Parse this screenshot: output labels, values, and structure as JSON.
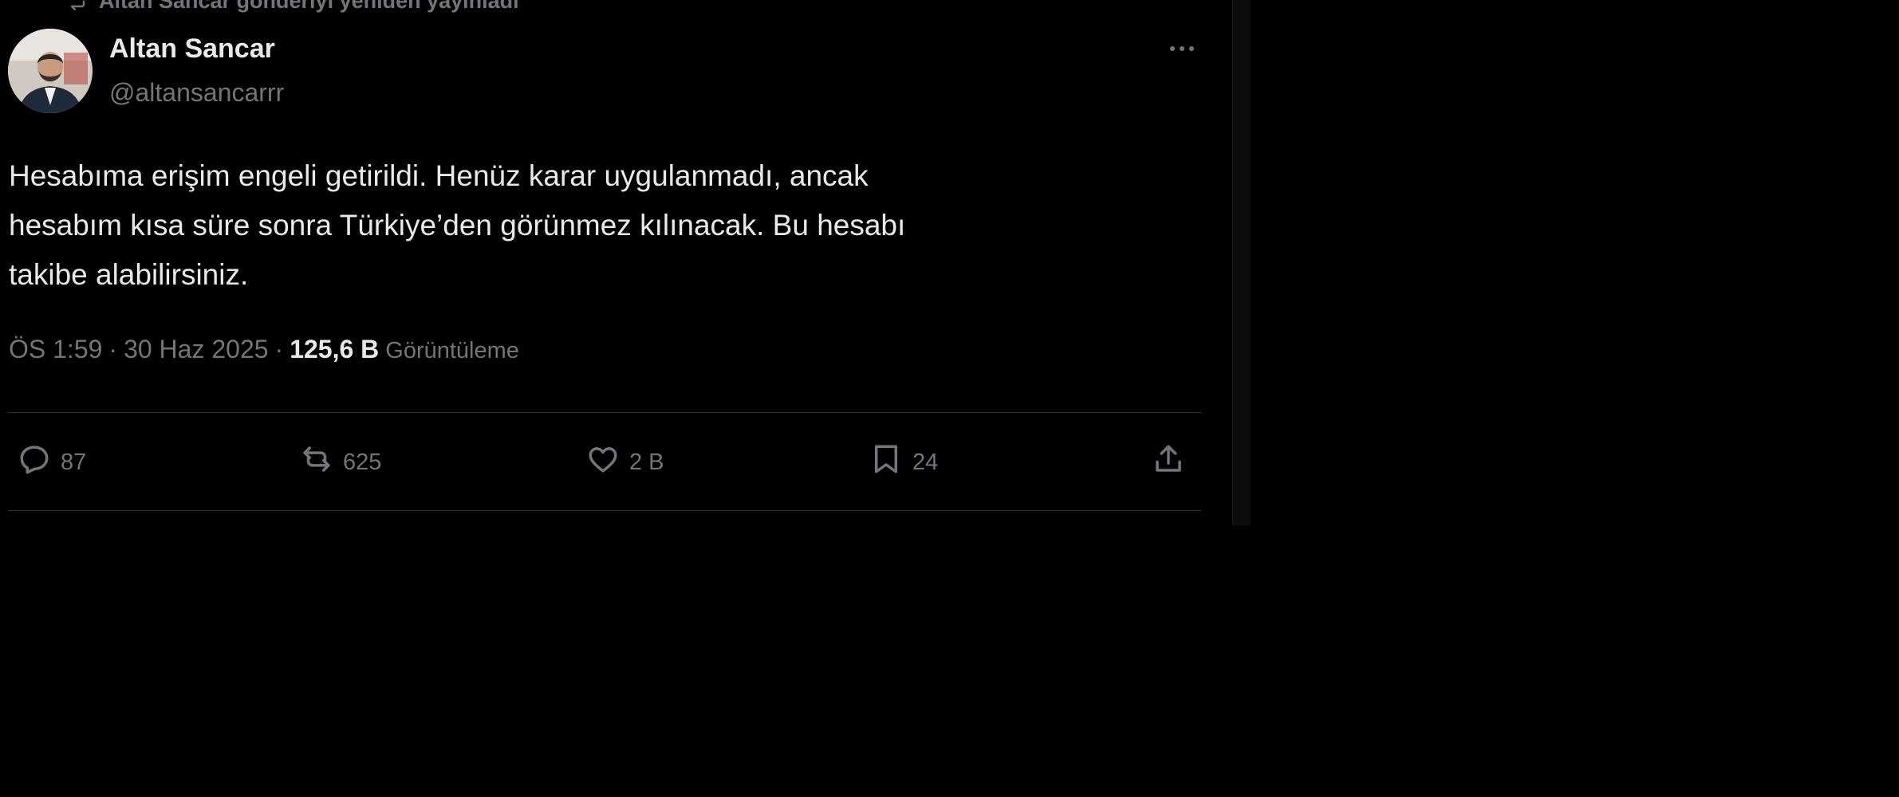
{
  "repost_notice": "Altan Sancar gönderiyi yeniden yayınladı",
  "author": {
    "display_name": "Altan Sancar",
    "handle": "@altansancarrr",
    "avatar_icon": "profile-photo"
  },
  "tweet": {
    "text_lines": [
      "Hesabıma erişim engeli getirildi. Henüz karar uygulanmadı, ancak",
      "hesabım kısa süre sonra Türkiye’den görünmez kılınacak. Bu hesabı",
      "takibe alabilirsiniz."
    ],
    "time": "ÖS 1:59",
    "date": "30 Haz 2025",
    "separator": "·",
    "views_count": "125,6 B",
    "views_label": "Görüntüleme"
  },
  "actions": {
    "replies": "87",
    "reposts": "625",
    "likes": "2 B",
    "bookmarks": "24"
  },
  "icons": {
    "repost": "repost-icon",
    "more": "more-icon",
    "reply": "reply-icon",
    "like": "heart-icon",
    "bookmark": "bookmark-icon",
    "share": "share-icon"
  },
  "colors": {
    "background": "#000000",
    "text": "#e7e9ea",
    "muted": "#71767b",
    "divider": "#2f3336"
  }
}
